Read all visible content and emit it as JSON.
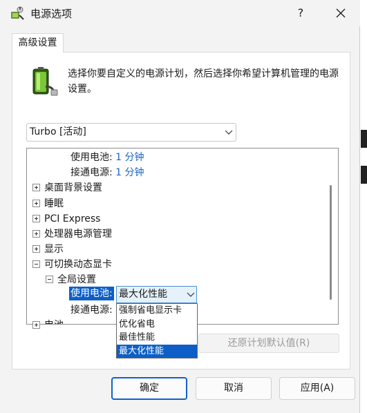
{
  "window": {
    "title": "电源选项",
    "help": "?",
    "close_icon": "close-icon"
  },
  "tabs": [
    {
      "label": "高级设置"
    }
  ],
  "description": "选择你要自定义的电源计划，然后选择你希望计算机管理的电源设置。",
  "plan_select": {
    "value": "Turbo [活动]"
  },
  "tree": {
    "rows": [
      {
        "label": "使用电池:",
        "value": "1 分钟"
      },
      {
        "label": "接通电源:",
        "value": "1 分钟"
      },
      {
        "label": "桌面背景设置"
      },
      {
        "label": "睡眠"
      },
      {
        "label": "PCI Express"
      },
      {
        "label": "处理器电源管理"
      },
      {
        "label": "显示"
      },
      {
        "label": "可切换动态显卡"
      },
      {
        "label": "全局设置"
      },
      {
        "label": "使用电池:"
      },
      {
        "label": "接通电源:"
      },
      {
        "label": "电池"
      }
    ]
  },
  "combo": {
    "value": "最大化性能",
    "options": [
      "强制省电显示卡",
      "优化省电",
      "最佳性能",
      "最大化性能"
    ],
    "selected_index": 3
  },
  "buttons": {
    "restore": "还原计划默认值(R)",
    "ok": "确定",
    "cancel": "取消",
    "apply": "应用(A)"
  },
  "colors": {
    "accent": "#0d5fc7",
    "value_text": "#1a63c6"
  }
}
